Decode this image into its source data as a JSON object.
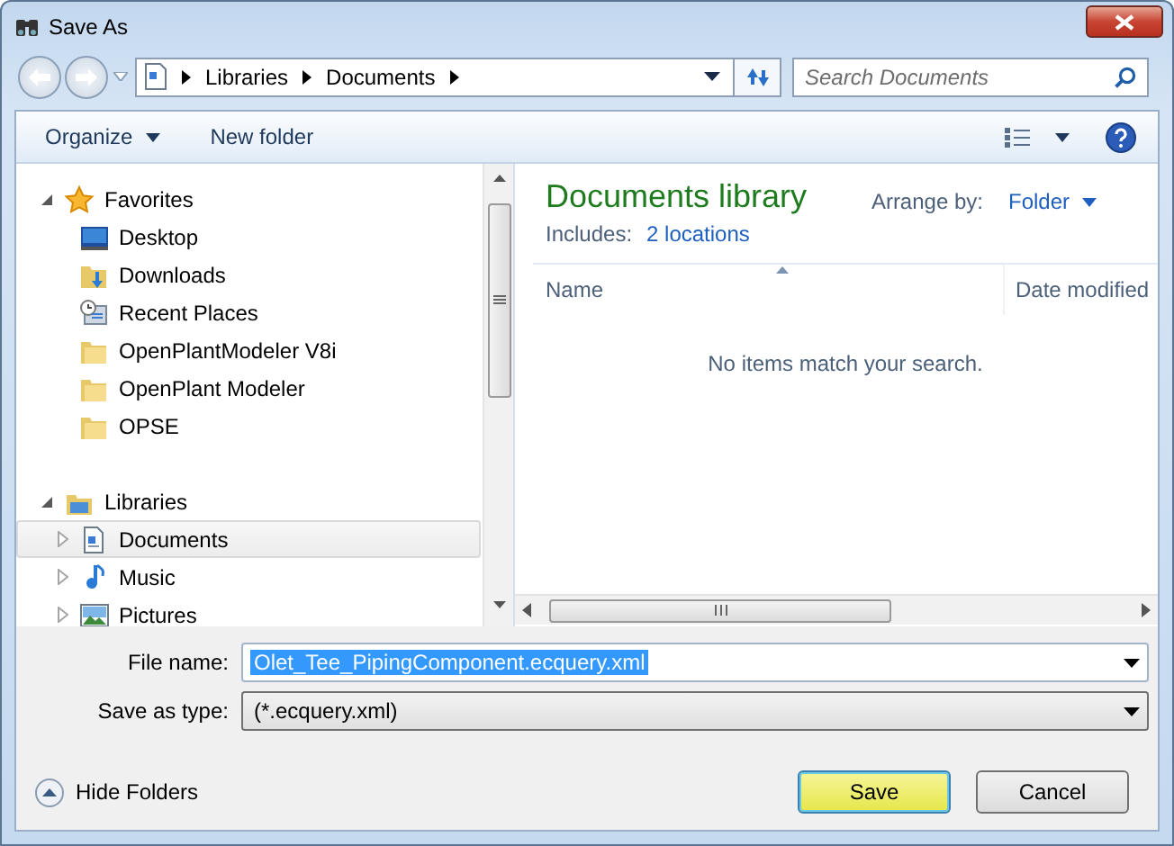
{
  "window": {
    "title": "Save As"
  },
  "address": {
    "path": [
      "Libraries",
      "Documents"
    ]
  },
  "search": {
    "placeholder": "Search Documents"
  },
  "toolbar": {
    "organize": "Organize",
    "new_folder": "New folder"
  },
  "navigation": [
    {
      "label": "Favorites",
      "kind": "star",
      "expanded": true,
      "selected": false,
      "children": [
        {
          "label": "Desktop",
          "kind": "desktop",
          "selected": false
        },
        {
          "label": "Downloads",
          "kind": "downloads",
          "selected": false
        },
        {
          "label": "Recent Places",
          "kind": "recent",
          "selected": false
        },
        {
          "label": "OpenPlantModeler V8i",
          "kind": "folder",
          "selected": false
        },
        {
          "label": "OpenPlant Modeler",
          "kind": "folder",
          "selected": false
        },
        {
          "label": "OPSE",
          "kind": "folder",
          "selected": false
        }
      ]
    },
    {
      "label": "Libraries",
      "kind": "library",
      "expanded": true,
      "selected": false,
      "children": [
        {
          "label": "Documents",
          "kind": "document",
          "expanded": false,
          "selected": true
        },
        {
          "label": "Music",
          "kind": "music",
          "expanded": false,
          "selected": false
        },
        {
          "label": "Pictures",
          "kind": "pictures",
          "expanded": false,
          "selected": false
        }
      ]
    }
  ],
  "library": {
    "title": "Documents library",
    "includes_label": "Includes:",
    "includes_link": "2 locations",
    "arrange_label": "Arrange by:",
    "arrange_value": "Folder"
  },
  "file_list": {
    "columns": [
      "Name",
      "Date modified"
    ],
    "empty_message": "No items match your search."
  },
  "form": {
    "file_name": {
      "label": "File name:",
      "value": "Olet_Tee_PipingComponent.ecquery.xml",
      "selected": true
    },
    "save_type": {
      "label": "Save as type:",
      "value": "(*.ecquery.xml)"
    }
  },
  "hide_folders": "Hide Folders",
  "buttons": [
    {
      "label": "Save",
      "default": true
    },
    {
      "label": "Cancel",
      "default": false
    }
  ]
}
